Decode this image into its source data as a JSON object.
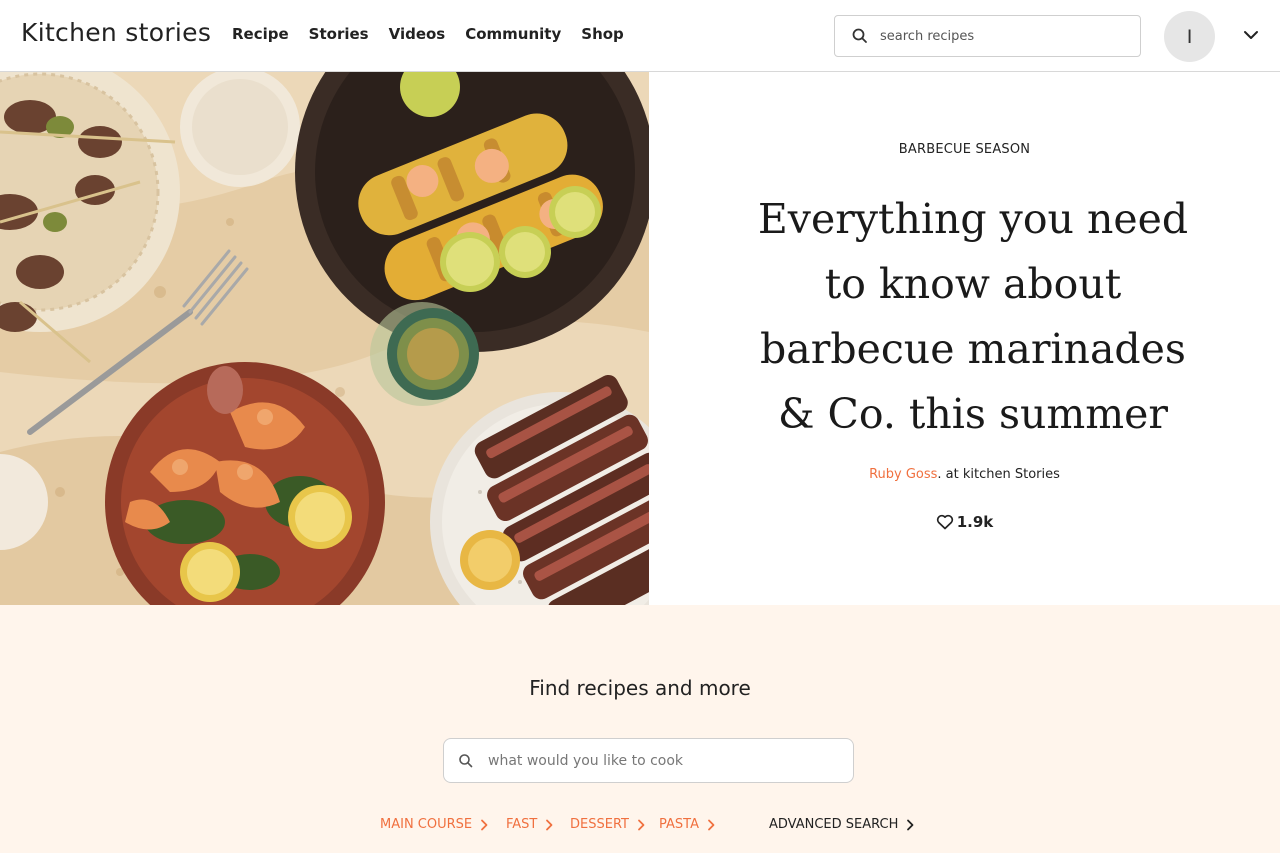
{
  "header": {
    "logo": "Kitchen stories",
    "nav": [
      "Recipe",
      "Stories",
      "Videos",
      "Community",
      "Shop"
    ],
    "search_placeholder": "search recipes",
    "avatar_initial": "I"
  },
  "hero": {
    "kicker": "BARBECUE SEASON",
    "headline": "Everything you need to know about barbecue marinades & Co. this summer",
    "author": "Ruby Goss",
    "byline_suffix": ". at kitchen Stories",
    "likes": "1.9k"
  },
  "find": {
    "title": "Find recipes and more",
    "search_placeholder": "what would you like to cook",
    "categories": [
      "MAIN COURSE",
      "FAST",
      "DESSERT",
      "PASTA"
    ],
    "advanced_search": "ADVANCED SEARCH"
  },
  "colors": {
    "accent": "#f0703f",
    "band_background": "#fff5ec"
  }
}
